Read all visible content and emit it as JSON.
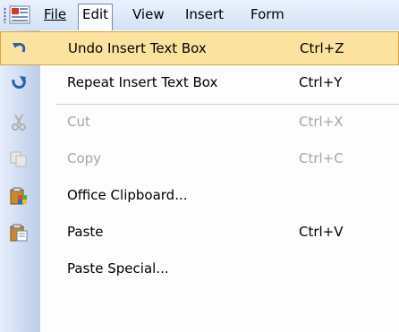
{
  "menubar": {
    "items": [
      {
        "label": "File"
      },
      {
        "label": "Edit"
      },
      {
        "label": "View"
      },
      {
        "label": "Insert"
      },
      {
        "label": "Form"
      }
    ]
  },
  "edit_menu": {
    "items": [
      {
        "label": "Undo Insert Text Box",
        "shortcut": "Ctrl+Z",
        "icon": "undo-icon",
        "enabled": true,
        "highlighted": true
      },
      {
        "label": "Repeat Insert Text Box",
        "shortcut": "Ctrl+Y",
        "icon": "repeat-icon",
        "enabled": true
      },
      {
        "label": "Cut",
        "shortcut": "Ctrl+X",
        "icon": "scissors-icon",
        "enabled": false
      },
      {
        "label": "Copy",
        "shortcut": "Ctrl+C",
        "icon": "copy-icon",
        "enabled": false
      },
      {
        "label": "Office Clipboard...",
        "shortcut": "",
        "icon": "office-clipboard-icon",
        "enabled": true
      },
      {
        "label": "Paste",
        "shortcut": "Ctrl+V",
        "icon": "paste-icon",
        "enabled": true
      },
      {
        "label": "Paste Special...",
        "shortcut": "",
        "icon": "",
        "enabled": true
      }
    ]
  },
  "colors": {
    "highlight_fill": "#fbe39f",
    "highlight_border": "#d4a545",
    "disabled_text": "#a7a7a7",
    "menubar_bg": "#d3e2f8"
  }
}
